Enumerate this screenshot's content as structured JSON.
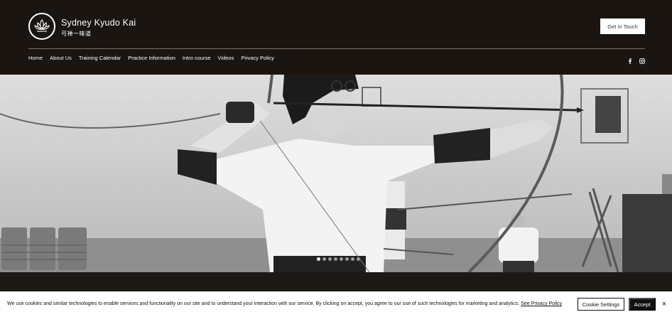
{
  "header": {
    "brand_name": "Sydney Kyudo Kai",
    "brand_subtitle": "弓禅一味道",
    "cta_label": "Get In Touch"
  },
  "nav": {
    "items": [
      {
        "label": "Home"
      },
      {
        "label": "About Us"
      },
      {
        "label": "Training Calendar"
      },
      {
        "label": "Practice Information"
      },
      {
        "label": "Intro course"
      },
      {
        "label": "Videos"
      },
      {
        "label": "Privacy Policy"
      }
    ]
  },
  "social": {
    "icons": [
      "facebook-icon",
      "instagram-icon"
    ]
  },
  "slideshow": {
    "slide_count": 8,
    "active_index": 0
  },
  "cookie_banner": {
    "text": "We use cookies and similar technologies to enable services and functionality on our site and to understand your interaction with our service. By clicking on accept, you agree to our use of such technologies for marketing and analytics.",
    "policy_link": "See Privacy Policy",
    "settings_label": "Cookie Settings",
    "accept_label": "Accept",
    "close_glyph": "×"
  },
  "colors": {
    "header_bg": "#1a1511",
    "cookie_bg": "#ffffff",
    "accept_bg": "#111111"
  }
}
